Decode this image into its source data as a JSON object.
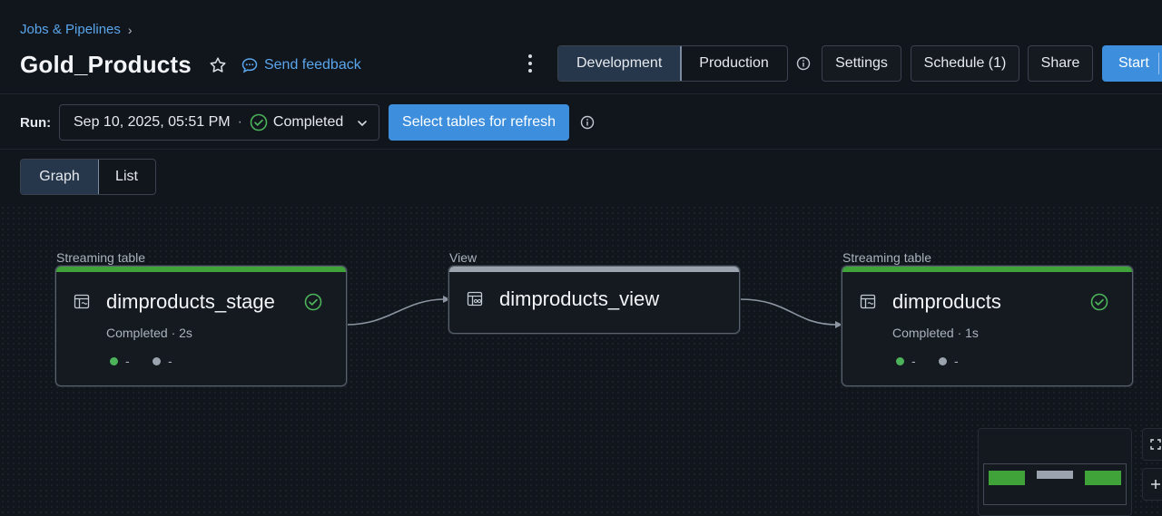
{
  "breadcrumb": {
    "parent": "Jobs & Pipelines",
    "separator": "›"
  },
  "page": {
    "title": "Gold_Products",
    "feedback_label": "Send feedback"
  },
  "mode_toggle": {
    "development": "Development",
    "production": "Production",
    "active": "Development"
  },
  "toolbar": {
    "settings": "Settings",
    "schedule": "Schedule (1)",
    "share": "Share",
    "start": "Start"
  },
  "run": {
    "label": "Run:",
    "timestamp": "Sep 10, 2025, 05:51 PM",
    "separator": "·",
    "status": "Completed",
    "refresh_button": "Select tables for refresh"
  },
  "view_toggle": {
    "graph": "Graph",
    "list": "List",
    "active": "Graph"
  },
  "nodes": [
    {
      "type_label": "Streaming table",
      "name": "dimproducts_stage",
      "status": "Completed · 2s",
      "metric_a": "-",
      "metric_b": "-",
      "state": "completed"
    },
    {
      "type_label": "View",
      "name": "dimproducts_view",
      "state": "none"
    },
    {
      "type_label": "Streaming table",
      "name": "dimproducts",
      "status": "Completed · 1s",
      "metric_a": "-",
      "metric_b": "-",
      "state": "completed"
    }
  ],
  "colors": {
    "background": "#11151c",
    "accent_blue": "#3d8fdd",
    "link_blue": "#5aa6ec",
    "success_green": "#3fa33a",
    "view_gray": "#9aa3ae"
  },
  "icons": {
    "breadcrumb_sep": "chevron-right-icon",
    "favorite": "star-icon",
    "feedback": "chat-bubble-icon",
    "more": "kebab-menu-icon",
    "info": "info-icon",
    "status": "check-circle-icon",
    "dropdown": "chevron-down-icon",
    "table": "table-icon",
    "fullscreen": "fullscreen-icon",
    "zoom_in": "plus-icon"
  }
}
